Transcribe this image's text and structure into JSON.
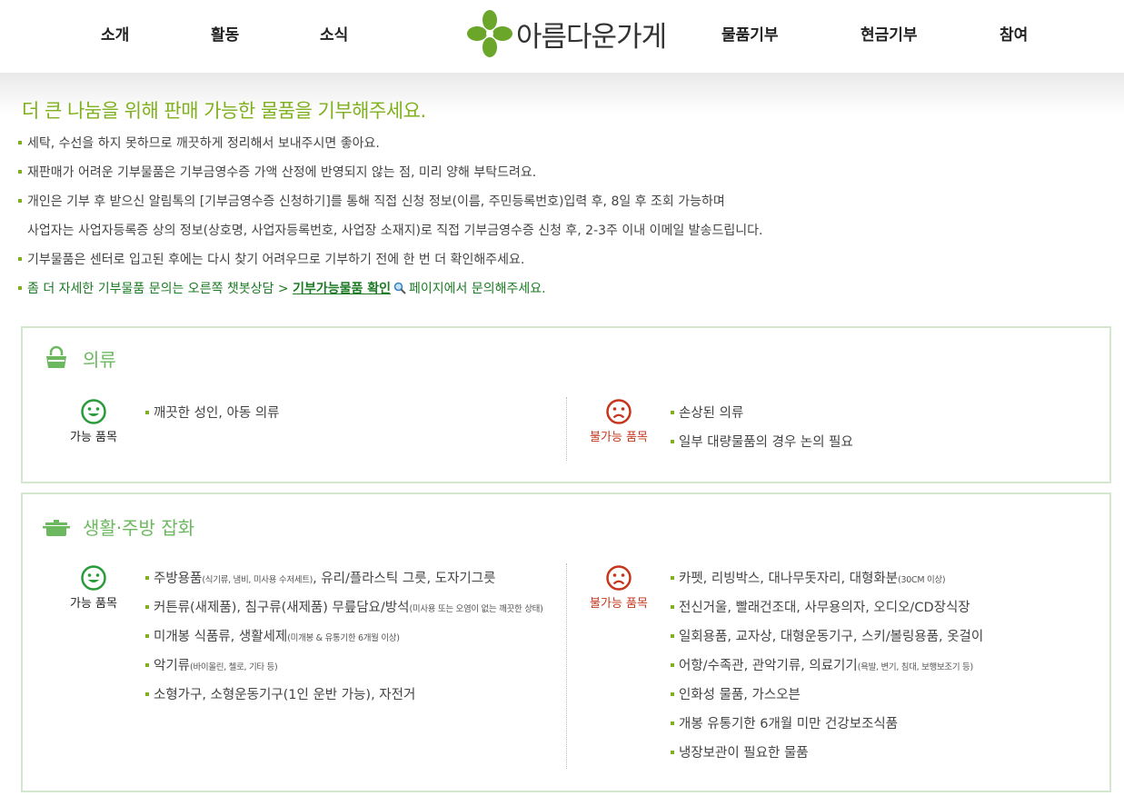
{
  "header": {
    "nav_left": [
      "소개",
      "활동",
      "소식"
    ],
    "nav_right": [
      "물품기부",
      "현금기부",
      "참여"
    ],
    "logo_text": "아름다운가게"
  },
  "intro": {
    "title": "더 큰 나눔을 위해 판매 가능한 물품을 기부해주세요.",
    "lines": [
      "세탁, 수선을 하지 못하므로 깨끗하게 정리해서 보내주시면 좋아요.",
      "재판매가 어려운 기부물품은 기부금영수증 가액 산정에 반영되지 않는 점, 미리 양해 부탁드려요.",
      "개인은 기부 후 받으신 알림톡의 [기부금영수증 신청하기]를 통해 직접 신청 정보(이름, 주민등록번호)입력 후, 8일 후 조회 가능하며",
      "사업자는 사업자등록증 상의 정보(상호명, 사업자등록번호, 사업장 소재지)로 직접 기부금영수증 신청 후, 2-3주 이내 이메일 발송드립니다.",
      "기부물품은 센터로 입고된 후에는 다시 찾기 어려우므로 기부하기 전에 한 번 더 확인해주세요."
    ],
    "highlight": {
      "prefix": "좀 더 자세한 기부물품 문의는 오른쪽 챗봇상담 >",
      "link": "기부가능물품 확인",
      "suffix": "페이지에서 문의해주세요."
    }
  },
  "labels": {
    "ok": "가능 품목",
    "no": "불가능 품목"
  },
  "categories": [
    {
      "title": "의류",
      "icon": "bag-icon",
      "allowed": [
        {
          "text": "깨끗한 성인, 아동 의류",
          "note": "",
          "rest": ""
        }
      ],
      "disallowed": [
        {
          "text": "손상된 의류",
          "note": "",
          "rest": ""
        },
        {
          "text": "일부 대량물품의 경우 논의 필요",
          "note": "",
          "rest": ""
        }
      ]
    },
    {
      "title": "생활·주방 잡화",
      "icon": "pot-icon",
      "allowed": [
        {
          "text": "주방용품",
          "note": "(식기류, 냄비, 미사용 수저세트)",
          "rest": ", 유리/플라스틱 그릇, 도자기그릇"
        },
        {
          "text": "커튼류(새제품), 침구류(새제품) 무릎담요/방석",
          "note": "(미사용 또는 오염이 없는 깨끗한 상태)",
          "rest": ""
        },
        {
          "text": "미개봉 식품류, 생활세제",
          "note": "(미개봉 & 유통기한 6개월 이상)",
          "rest": ""
        },
        {
          "text": "악기류",
          "note": "(바이올린, 첼로, 기타 등)",
          "rest": ""
        },
        {
          "text": "소형가구, 소형운동기구(1인 운반 가능), 자전거",
          "note": "",
          "rest": ""
        }
      ],
      "disallowed": [
        {
          "text": "카펫, 리빙박스, 대나무돗자리, 대형화분",
          "note": "(30CM 이상)",
          "rest": ""
        },
        {
          "text": "전신거울, 빨래건조대, 사무용의자, 오디오/CD장식장",
          "note": "",
          "rest": ""
        },
        {
          "text": "일회용품, 교자상, 대형운동기구, 스키/볼링용품, 옷걸이",
          "note": "",
          "rest": ""
        },
        {
          "text": "어항/수족관, 관악기류, 의료기기",
          "note": "(욕발, 변기, 침대, 보행보조기 등)",
          "rest": ""
        },
        {
          "text": "인화성 물품, 가스오븐",
          "note": "",
          "rest": ""
        },
        {
          "text": "개봉 유통기한 6개월 미만 건강보조식품",
          "note": "",
          "rest": ""
        },
        {
          "text": "냉장보관이 필요한 물품",
          "note": "",
          "rest": ""
        }
      ]
    }
  ],
  "colors": {
    "brand_green": "#7fb01d",
    "box_border": "#d3e6ce",
    "category_title": "#6cb85f",
    "ok_face": "#2a9b3a",
    "no_face": "#c5361c",
    "link_green": "#1b7a23"
  }
}
